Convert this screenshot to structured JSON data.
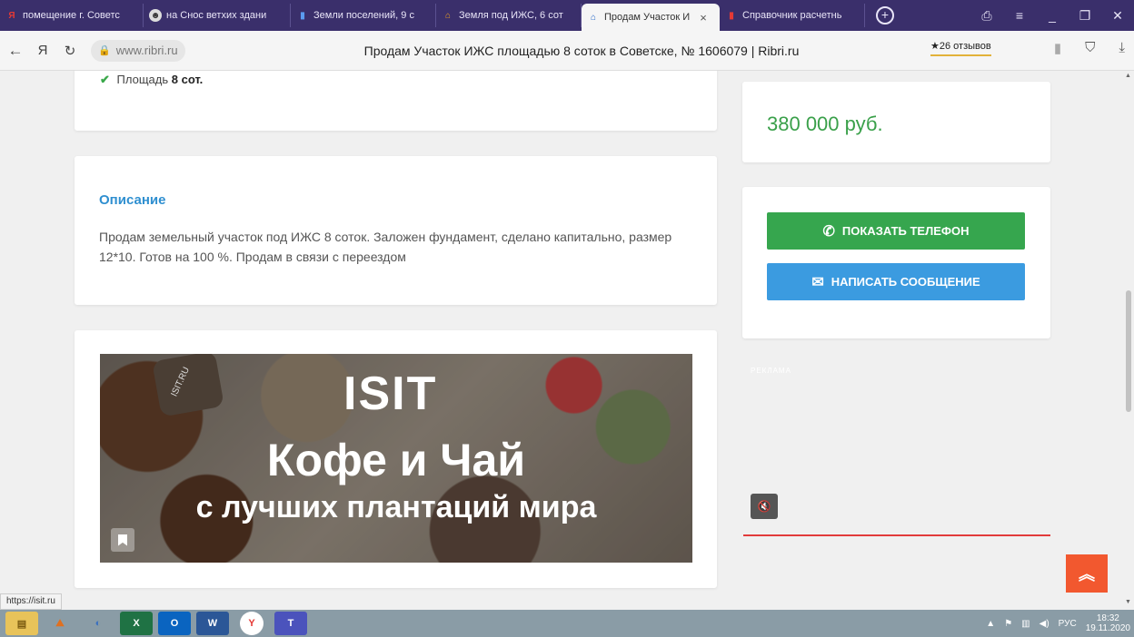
{
  "browser": {
    "tabs": [
      {
        "label": "помещение г. Советс",
        "icon": "Я",
        "color": "#e53935"
      },
      {
        "label": "на Снос ветхих здани",
        "icon": "☻",
        "color": "#6d6d6d"
      },
      {
        "label": "Земли поселений, 9 с",
        "icon": "▮",
        "color": "#1e63c6"
      },
      {
        "label": "Земля под ИЖС, 6 сот",
        "icon": "⌂",
        "color": "#f0a020"
      },
      {
        "label": "Продам Участок И",
        "icon": "⌂",
        "color": "#1e63c6",
        "active": true
      },
      {
        "label": "Справочник расчетнь",
        "icon": "▮",
        "color": "#c62828"
      }
    ],
    "close_glyph": "×",
    "newtab_glyph": "+",
    "window_controls": [
      "⎙",
      "≡",
      "_",
      "❐",
      "✕"
    ],
    "address": "www.ribri.ru",
    "page_title": "Продам Участок ИЖС площадью 8 соток в Советске, № 1606079 | Ribri.ru",
    "reviews": "★26 отзывов",
    "status_url": "https://isit.ru"
  },
  "listing": {
    "area_label": "Площадь",
    "area_value": "8 сот.",
    "description_heading": "Описание",
    "description_text": "Продам земельный участок под ИЖС 8 соток. Заложен фундамент, сделано капитально, размер 12*10. Готов на 100 %. Продам в связи с переездом",
    "price": "380 000 руб.",
    "show_phone_label": "Показать телефон",
    "write_message_label": "Написать сообщение"
  },
  "ad": {
    "logo": "ISIT",
    "sack_text": "ISIT.RU",
    "headline": "Кофе и Чай",
    "subline": "с лучших плантаций мира",
    "reklama_label": "РЕКЛАМА",
    "mute_glyph": "🔇"
  },
  "scroll_top_glyph": "︽",
  "taskbar": {
    "apps": [
      "▤",
      "⛰",
      "◐",
      "X",
      "O",
      "W",
      "Y",
      "T"
    ],
    "lang": "РУС",
    "time": "18:32",
    "date": "19.11.2020"
  },
  "colors": {
    "price_green": "#3aa04a",
    "heading_blue": "#2f8fd0",
    "phone_btn": "#36a64e",
    "msg_btn": "#3b9be0",
    "scroll_top": "#f2582f"
  }
}
